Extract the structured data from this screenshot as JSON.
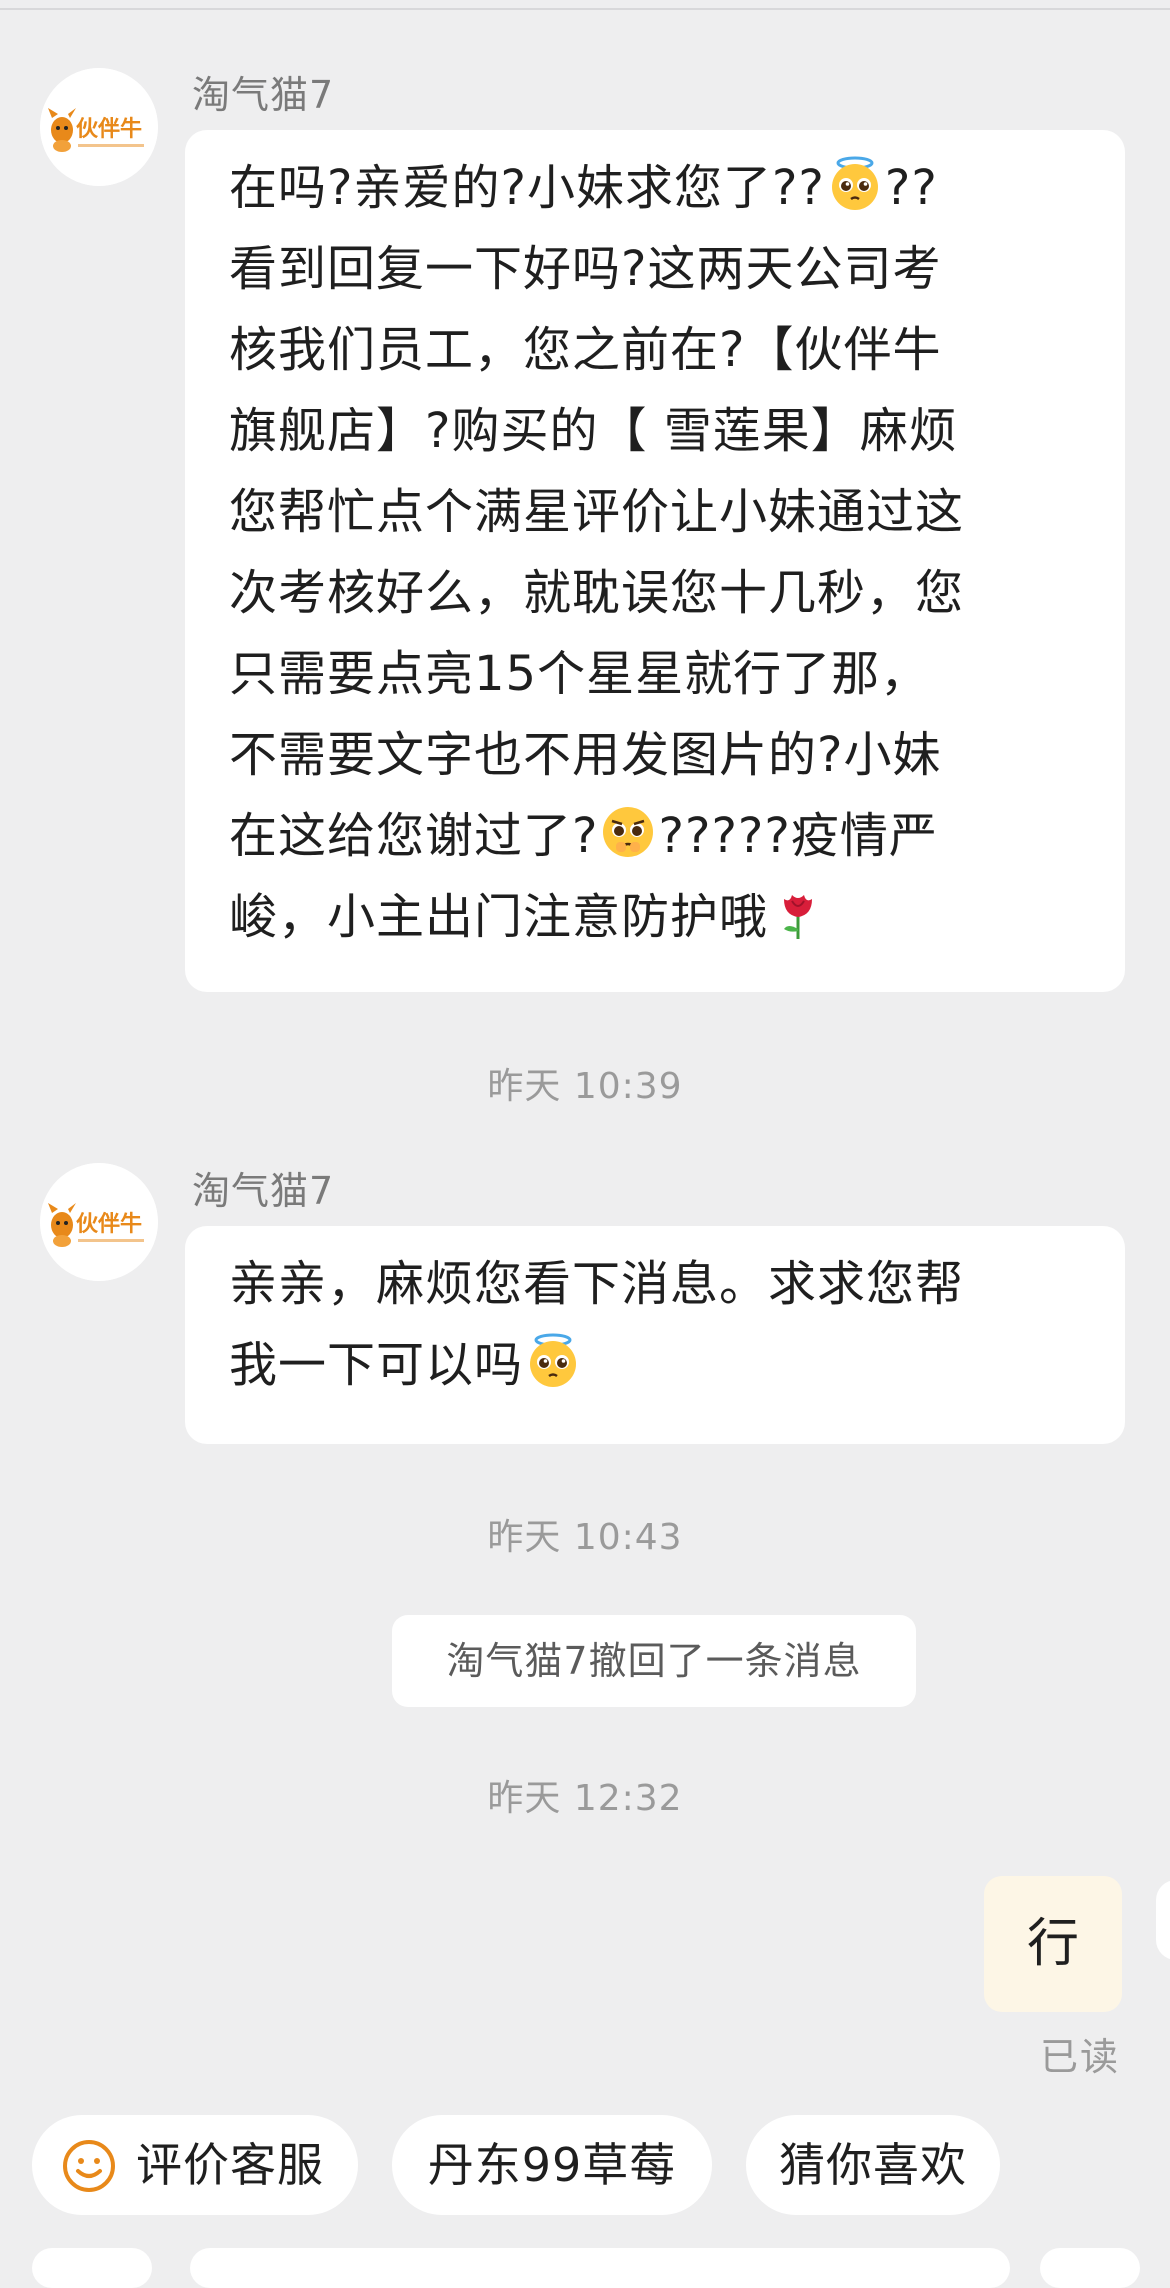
{
  "messages": [
    {
      "sender": "淘气猫7",
      "lines": [
        "在吗?亲爱的?小妹求您了??",
        "??",
        "看到回复一下好吗?这两天公司考",
        "核我们员工，您之前在?【伙伴牛",
        "旗舰店】?购买的【 雪莲果】麻烦",
        "您帮忙点个满星评价让小妹通过这",
        "次考核好么，就耽误您十几秒，您",
        "只需要点亮15个星星就行了那，",
        "不需要文字也不用发图片的?小妹",
        "在这给您谢过了?",
        "?????疫情严",
        "峻，小主出门注意防护哦"
      ]
    },
    {
      "sender": "淘气猫7",
      "lines": [
        "亲亲，麻烦您看下消息。求求您帮",
        "我一下可以吗"
      ]
    }
  ],
  "timestamps": [
    "昨天 10:39",
    "昨天 10:43",
    "昨天 12:32"
  ],
  "system_notice": "淘气猫7撤回了一条消息",
  "my_message": "行",
  "read_status": "已读",
  "avatar": {
    "logo_text": "伙伴牛",
    "icon": "cow-logo-icon",
    "brand_color": "#e8891a"
  },
  "quick_replies": [
    {
      "label": "评价客服",
      "icon": "smile-icon"
    },
    {
      "label": "丹东99草莓"
    },
    {
      "label": "猜你喜欢"
    }
  ],
  "emojis": [
    "halo-pleading-face-icon",
    "pleading-face-icon",
    "rose-icon"
  ],
  "colors": {
    "background": "#eeeeef",
    "bubble": "#ffffff",
    "my_bubble": "#fdf6e6",
    "meta_text": "#9a9a9a",
    "accent": "#e8891a"
  }
}
